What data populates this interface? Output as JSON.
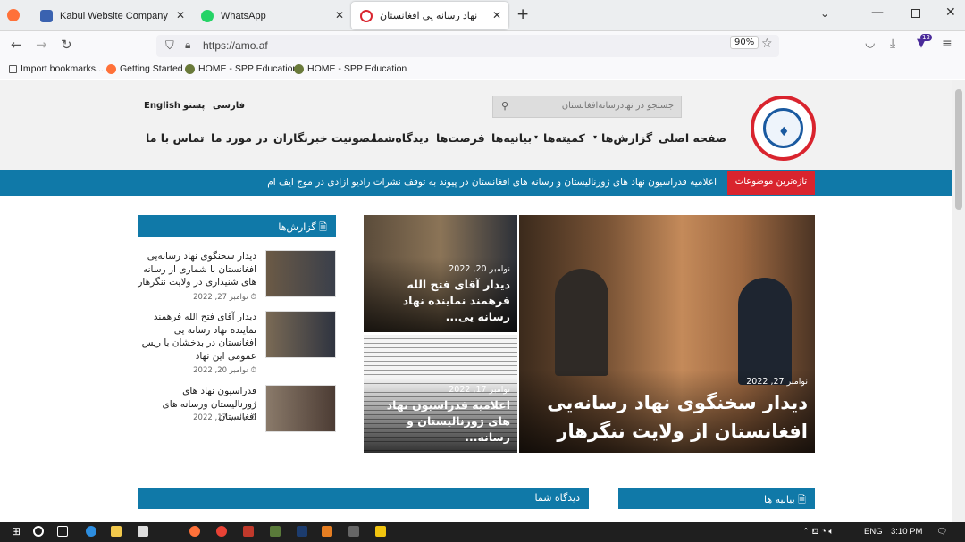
{
  "tabs": [
    {
      "title": "Kabul Website Company"
    },
    {
      "title": "WhatsApp"
    },
    {
      "title": "نهاد رسانه یی افغانستان"
    }
  ],
  "url": "https://amo.af",
  "zoom": "90%",
  "downloads_badge": "12",
  "bookmarks": [
    "Import bookmarks...",
    "Getting Started",
    "HOME - SPP Education",
    "HOME - SPP Education"
  ],
  "site": {
    "search_placeholder": "جستجو در نهادرسانه‌افغانستان",
    "languages": [
      "فارسی",
      "پښتو",
      "English"
    ],
    "menu": [
      "صفحه اصلی",
      "گزارش‌ها",
      "کمیته‌ها",
      "بیانیه‌ها",
      "فرصت‌ها",
      "دیدگاه‌شما",
      "مصونیت خبرنگاران",
      "در مورد ما",
      "تماس با ما"
    ],
    "ticker_label": "تازه‌ترین موضوعات",
    "ticker_text": "اعلامیه فدراسیون نهاد های ژورنالیستان و رسانه های افغانستان در پیوند به توقف نشرات رادیو ازادی در موج ایف ام",
    "featured_main": {
      "date": "نوامبر 27, 2022",
      "title": "دیدار سخنگوی نهاد رسانه‌یی افغانستان از ولایت ننگرهار"
    },
    "featured_top": {
      "date": "نوامبر 20, 2022",
      "title": "دیدار آقای فتح الله فرهمند نماینده نهاد رسانه یی..."
    },
    "featured_bottom": {
      "date": "نوامبر 17, 2022",
      "title": "اعلامیه فدراسیون نهاد های ژورنالیستان و رسانه..."
    },
    "reports_title": "گزارش‌ها",
    "reports": [
      {
        "title": "دیدار سخنگوی نهاد رسانه‌یی افغانستان با شماری از رسانه های شنیداری در ولایت ننگرهار",
        "date": "نوامبر 27, 2022"
      },
      {
        "title": "دیدار آقای فتح الله فرهمند نماینده نهاد رسانه یی افغانستان در بدخشان با ریس عمومی این نهاد",
        "date": "نوامبر 20, 2022"
      },
      {
        "title": "فدراسیون نهاد های ژورنالیستان ورسانه های افغانستان",
        "date": "نوامبر 17, 2022"
      }
    ],
    "box_opinions": "دیدگاه شما",
    "box_statements": "بیانیه ها"
  },
  "taskbar": {
    "lang": "ENG",
    "time": "3:10 PM"
  },
  "colors": {
    "accent": "#1079a8",
    "red": "#d9242e"
  }
}
